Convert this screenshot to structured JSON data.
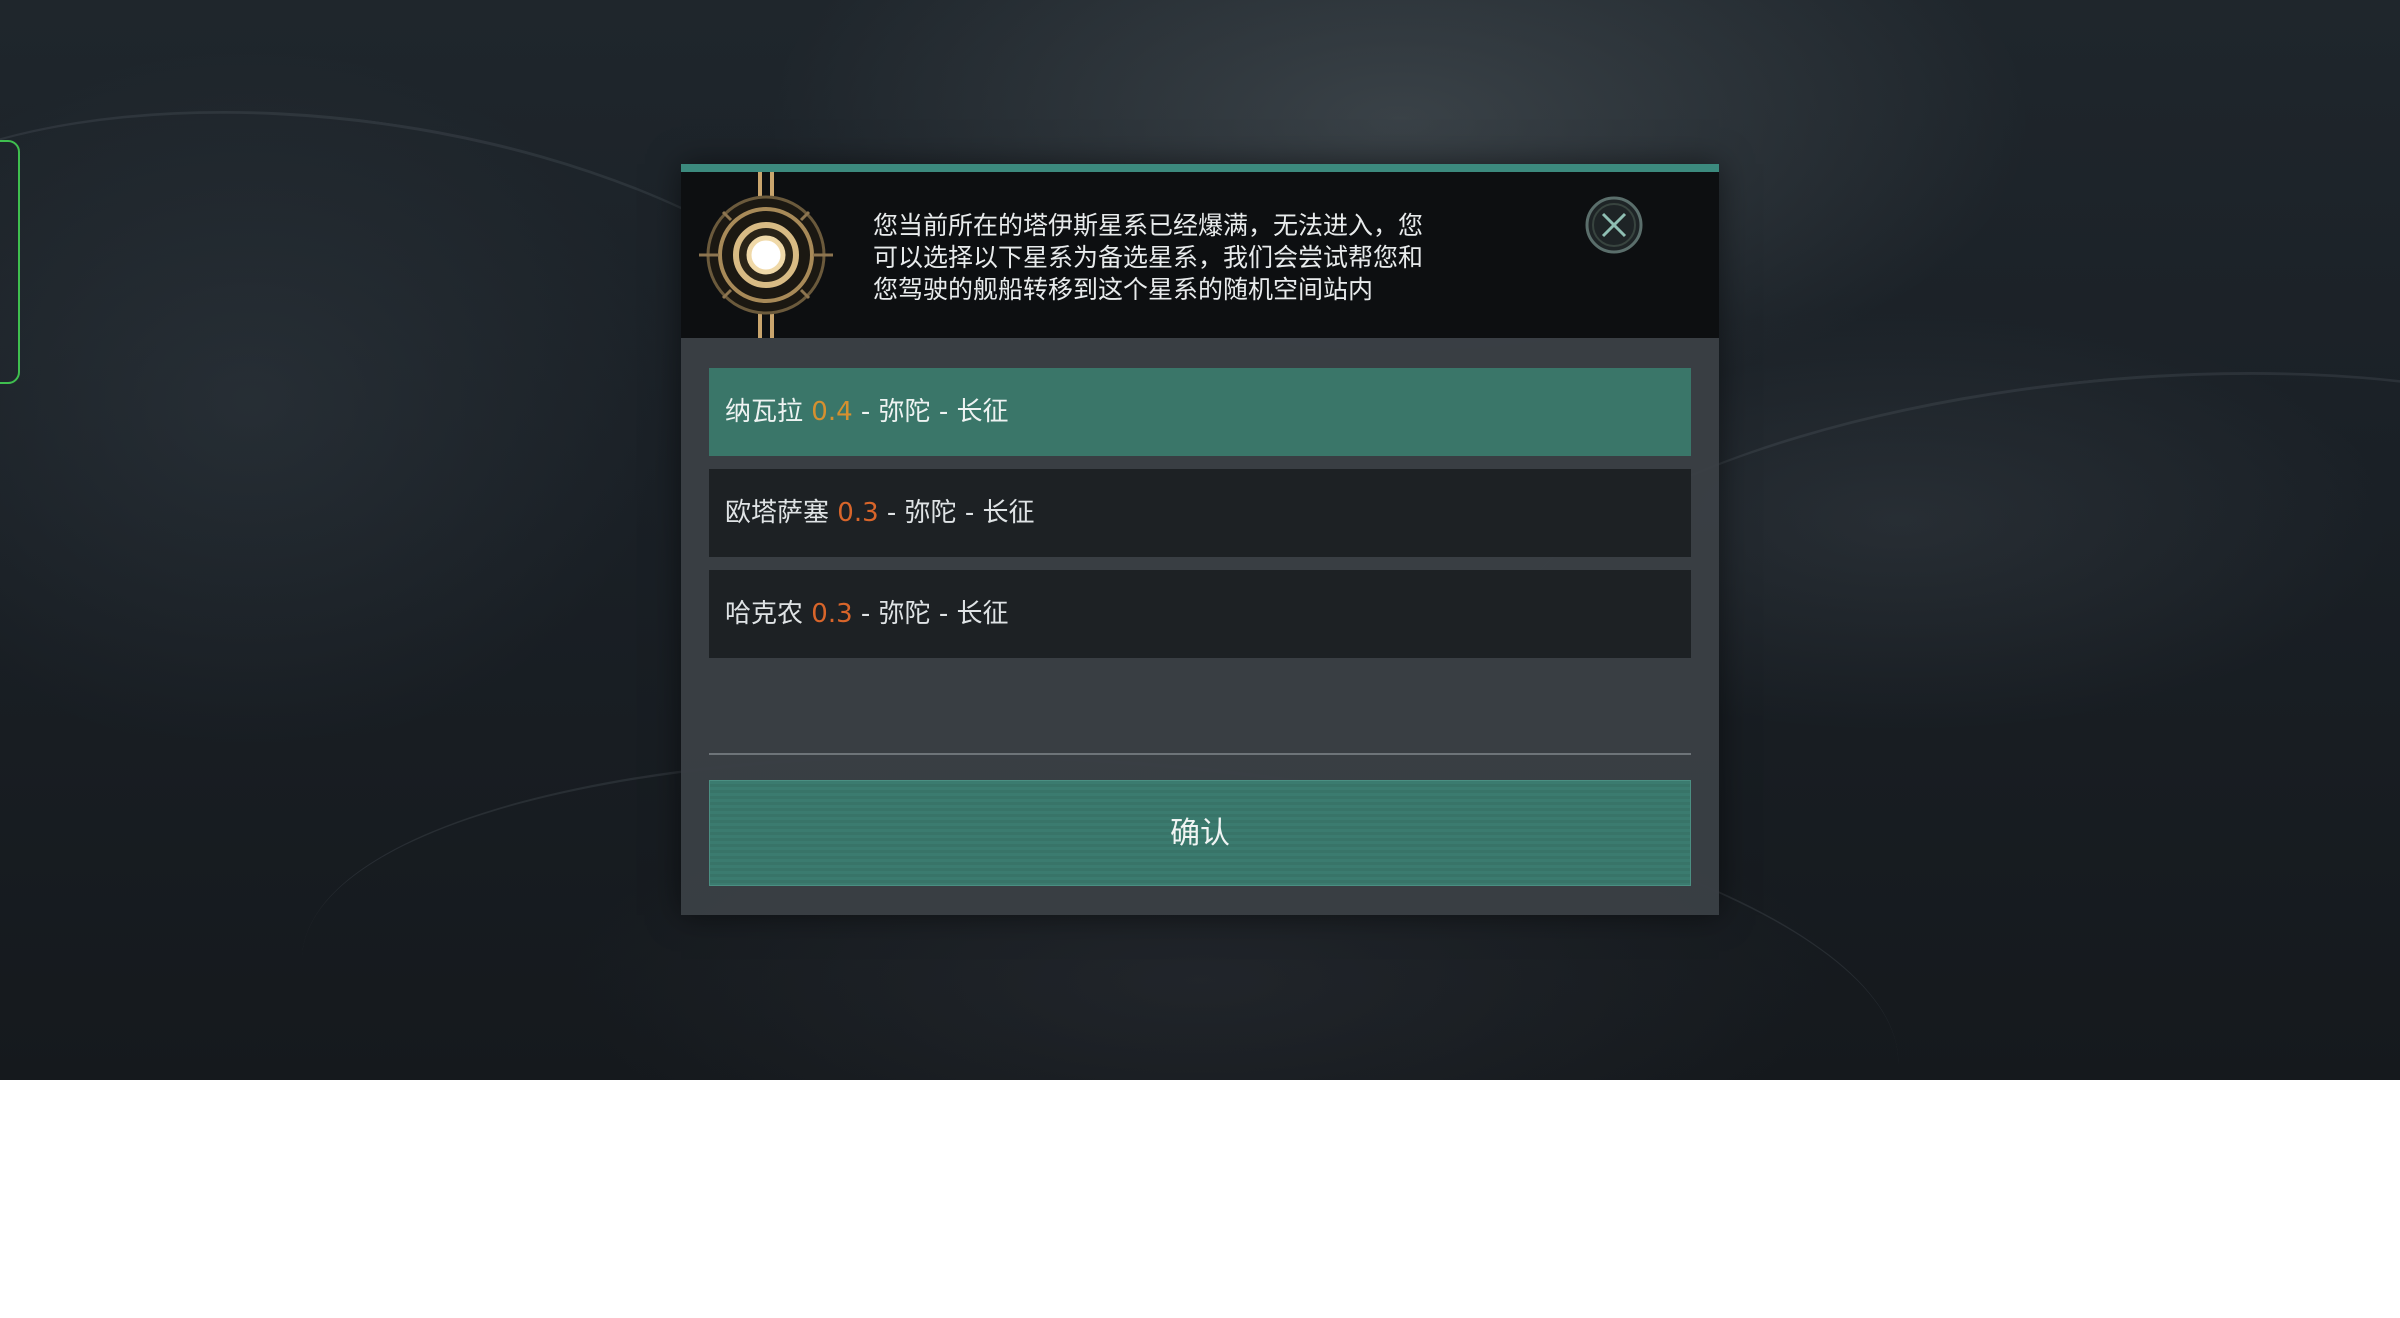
{
  "dialog": {
    "header_lines": [
      "您当前所在的塔伊斯星系已经爆满，无法进入，您",
      "可以选择以下星系为备选星系，我们会尝试帮您和",
      "您驾驶的舰船转移到这个星系的随机空间站内"
    ],
    "close_icon": "close-icon",
    "emblem_icon": "emblem-icon",
    "options": [
      {
        "name": "纳瓦拉",
        "security": "0.4",
        "route": "- 弥陀 - 长征",
        "selected": true,
        "security_color": "#d6902f"
      },
      {
        "name": "欧塔萨塞",
        "security": "0.3",
        "route": "- 弥陀 - 长征",
        "selected": false,
        "security_color": "#d8652a"
      },
      {
        "name": "哈克农",
        "security": "0.3",
        "route": "- 弥陀 - 长征",
        "selected": false,
        "security_color": "#d8652a"
      }
    ],
    "confirm_label": "确认"
  },
  "colors": {
    "accent": "#3c8a7e",
    "selected_row": "#3a7669",
    "header_bg": "#0d0f11",
    "emblem_gold": "#c9a56d"
  }
}
